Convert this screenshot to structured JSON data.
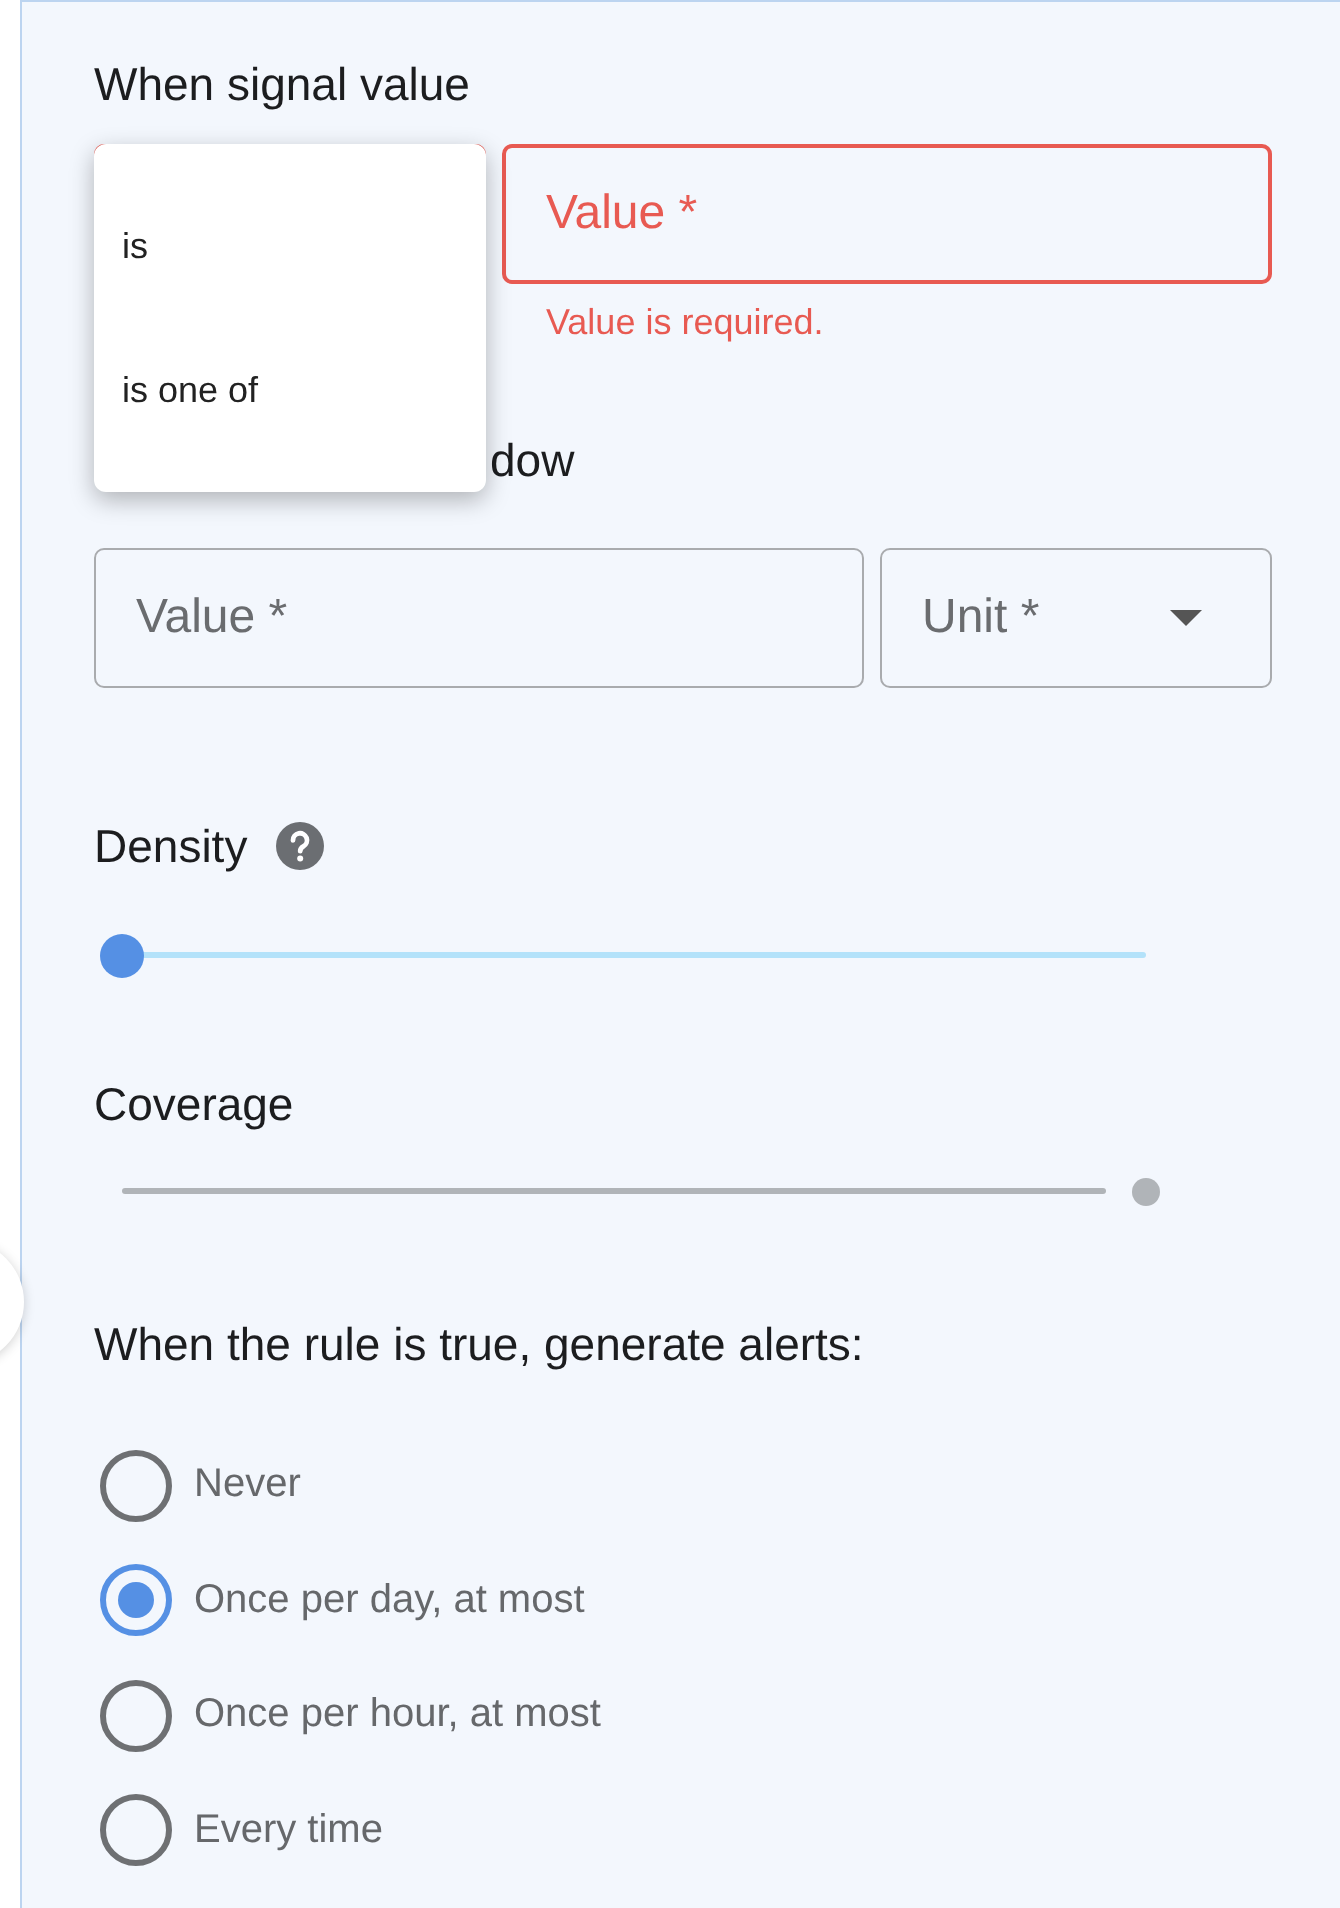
{
  "signal_section": {
    "title": "When signal value",
    "condition": {
      "invalid": true,
      "menu": [
        {
          "label": "is"
        },
        {
          "label": "is one of"
        }
      ]
    },
    "value": {
      "placeholder": "Value *",
      "invalid": true,
      "error": "Value is required."
    }
  },
  "window_section": {
    "title": "dow",
    "value": {
      "placeholder": "Value *"
    },
    "unit": {
      "placeholder": "Unit *"
    }
  },
  "sliders": [
    {
      "label": "Density",
      "help": true,
      "level": 0,
      "disabled": false
    },
    {
      "label": "Coverage",
      "help": false,
      "level": 1,
      "disabled": true
    }
  ],
  "alerts": {
    "title": "When the rule is true, generate alerts:",
    "options": [
      {
        "label": "Never",
        "selected": false
      },
      {
        "label": "Once per day, at most",
        "selected": true
      },
      {
        "label": "Once per hour, at most",
        "selected": false
      },
      {
        "label": "Every time",
        "selected": false
      }
    ]
  }
}
